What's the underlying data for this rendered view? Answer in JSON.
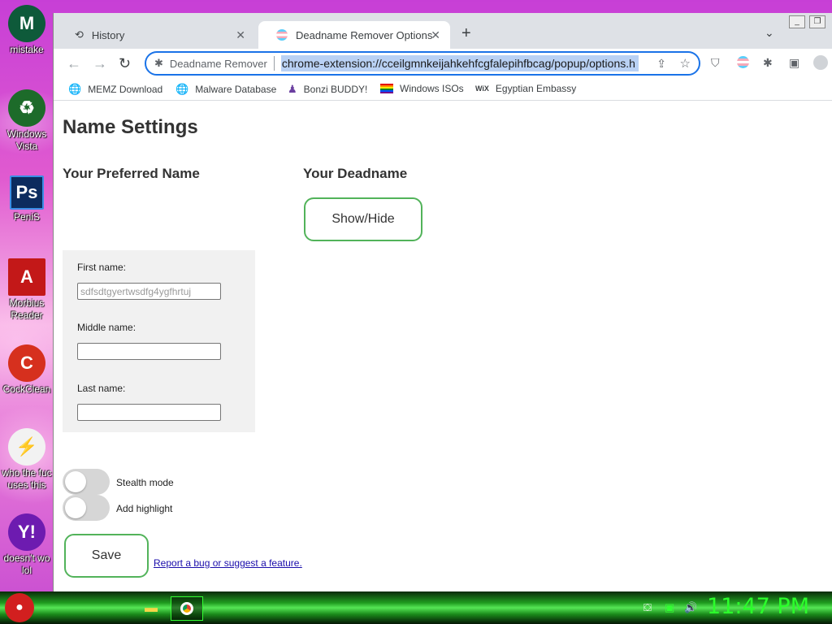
{
  "desktop": {
    "icons": [
      {
        "label": "mistake",
        "glyph": "M",
        "color": "#0e5a3a"
      },
      {
        "label": "Windows Vista",
        "glyph": "♻",
        "color": "#1d6b2a"
      },
      {
        "label": "PeniS",
        "glyph": "Ps",
        "color": "#0c2b5e"
      },
      {
        "label": "Morbius Reader",
        "glyph": "A",
        "color": "#c31818"
      },
      {
        "label": "CockClean",
        "glyph": "C",
        "color": "#d6301e"
      },
      {
        "label": "who the fuc uses this",
        "glyph": "⚡",
        "color": "#f2f2f2"
      },
      {
        "label": "doesn't wo lol",
        "glyph": "Y!",
        "color": "#6d1bb0"
      }
    ]
  },
  "window_controls": {
    "minimize": "_",
    "maximize": "❐"
  },
  "tabs": [
    {
      "title": "History",
      "icon": "history-icon",
      "close": "✕"
    },
    {
      "title": "Deadname Remover Options",
      "icon": "trans-flag-icon",
      "close": "✕"
    }
  ],
  "tabstrip": {
    "new_tab": "+",
    "tab_search": "⌄"
  },
  "toolbar": {
    "back": "←",
    "forward": "→",
    "reload": "↻",
    "site_name": "Deadname Remover",
    "url": "chrome-extension://cceilgmnkeijahkehfcgfalepihfbcag/popup/options.h",
    "share": "⇪",
    "star": "☆",
    "extensions": [
      "ublock-icon",
      "trans-flag-icon",
      "puzzle-icon",
      "side-panel-icon",
      "profile-icon"
    ]
  },
  "bookmarks": [
    {
      "label": "MEMZ Download",
      "icon": "globe-icon"
    },
    {
      "label": "Malware Database",
      "icon": "globe-icon"
    },
    {
      "label": "Bonzi BUDDY!",
      "icon": "bonzi-icon"
    },
    {
      "label": "Windows ISOs",
      "icon": "rainbow-flag-icon"
    },
    {
      "label": "Egyptian Embassy",
      "icon": "wix-icon"
    }
  ],
  "page": {
    "title": "Name Settings",
    "preferred_heading": "Your Preferred Name",
    "deadname_heading": "Your Deadname",
    "show_hide_label": "Show/Hide",
    "fields": {
      "first_label": "First name:",
      "first_placeholder": "sdfsdtgyertwsdfg4ygfhrtuj",
      "middle_label": "Middle name:",
      "middle_value": "",
      "last_label": "Last name:",
      "last_value": ""
    },
    "toggles": [
      {
        "label": "Stealth mode",
        "on": false
      },
      {
        "label": "Add highlight",
        "on": false
      }
    ],
    "save_label": "Save",
    "report_link": "Report a bug or suggest a feature."
  },
  "taskbar": {
    "clock": "11:47 PM",
    "items": [
      "folder-icon",
      "chrome-icon"
    ],
    "tray": [
      "network-icon",
      "monitor-icon",
      "volume-icon"
    ],
    "accent": "#2bff2b"
  }
}
